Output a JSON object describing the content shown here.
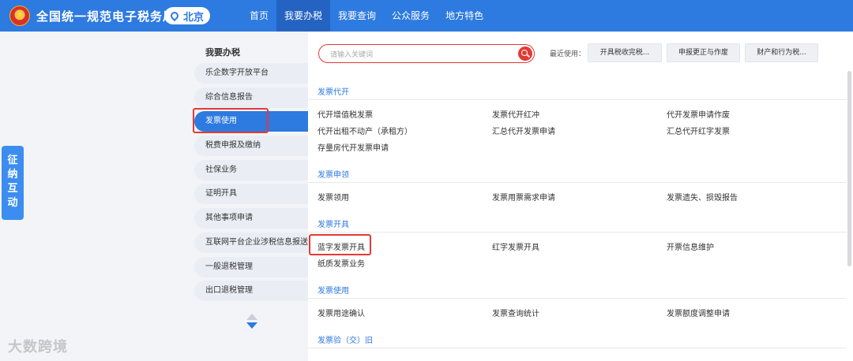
{
  "header": {
    "title": "全国统一规范电子税务局",
    "region": "北京",
    "nav": [
      "首页",
      "我要办税",
      "我要查询",
      "公众服务",
      "地方特色"
    ]
  },
  "float_tab": "征纳互动",
  "sidebar": {
    "heading": "我要办税",
    "items": [
      "乐企数字开放平台",
      "综合信息报告",
      "发票使用",
      "税费申报及缴纳",
      "社保业务",
      "证明开具",
      "其他事项申请",
      "互联网平台企业涉税信息报送",
      "一般退税管理",
      "出口退税管理"
    ],
    "active_index": 2
  },
  "search": {
    "placeholder": "请输入关键词"
  },
  "recent": {
    "label": "最近使用：",
    "items": [
      "开具税收完税...",
      "申报更正与作废",
      "财产和行为税..."
    ]
  },
  "sections": [
    {
      "title": "发票代开",
      "links": [
        "代开增值税发票",
        "发票代开红冲",
        "代开发票申请作废",
        "代开出租不动产（承租方）",
        "汇总代开发票申请",
        "汇总代开红字发票",
        "存量房代开发票申请"
      ]
    },
    {
      "title": "发票申领",
      "links": [
        "发票领用",
        "发票用票需求申请",
        "发票遗失、损毁报告"
      ]
    },
    {
      "title": "发票开具",
      "links": [
        "蓝字发票开具",
        "红字发票开具",
        "开票信息维护",
        "纸质发票业务"
      ]
    },
    {
      "title": "发票使用",
      "links": [
        "发票用途确认",
        "发票查询统计",
        "发票额度调整申请"
      ]
    },
    {
      "title": "发票验（交）旧",
      "links": []
    }
  ],
  "watermark": "大数跨境"
}
